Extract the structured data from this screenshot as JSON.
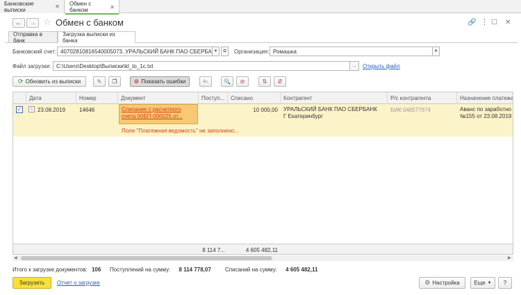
{
  "app_tabs": [
    {
      "label": "Банковские выписки"
    },
    {
      "label": "Обмен с банком"
    }
  ],
  "window": {
    "title": "Обмен с банком",
    "back_icon": "arrow-left-icon",
    "forward_icon": "arrow-right-icon"
  },
  "form_tabs": [
    {
      "label": "Отправка в банк"
    },
    {
      "label": "Загрузка выписки из банка"
    }
  ],
  "account": {
    "label": "Банковский счет:",
    "value": "40702810816540005073, УРАЛЬСКИЙ БАНК ПАО СБЕРБАНК"
  },
  "organization": {
    "label": "Организация:",
    "value": "Ромашка"
  },
  "file": {
    "label": "Файл загрузки:",
    "value": "C:\\Users\\Desktop\\Выписки\\kl_to_1c.txt",
    "browse": "...",
    "open_link": "Открыть файл"
  },
  "toolbar": {
    "refresh_label": "Обновить из выписки",
    "show_errors_label": "Показать ошибки"
  },
  "table": {
    "columns": [
      "Дата",
      "Номер",
      "Документ",
      "Поступ...",
      "Списано",
      "Контрагент",
      "Р/с контрагента",
      "Назначение платежа"
    ],
    "rows": [
      {
        "checked": true,
        "date": "23.08.2019",
        "number": "14646",
        "document_line1": "Списание с расчетного",
        "document_line2": "счета 00БП-000025 от...",
        "income": "",
        "debit": "10 000,00",
        "counterparty_line1": "УРАЛЬСКИЙ БАНК ПАО СБЕРБАНК",
        "counterparty_line2": "Г Екатеринбург",
        "account": "БИК 046577674",
        "purpose_line1": "Аванс по заработно",
        "purpose_line2": "№155 от 23.08.2019",
        "error": "Поле \"Платежная ведомость\" не заполнено..."
      }
    ],
    "totals": {
      "income": "8 114 7...",
      "debit": "4 605 482,11"
    }
  },
  "summary": {
    "docs_label": "Итого к загрузке документов:",
    "docs_value": "106",
    "income_label": "Поступлений на сумму:",
    "income_value": "8 114 778,07",
    "debit_label": "Списаний на сумму:",
    "debit_value": "4 605 482,11"
  },
  "footer": {
    "load_label": "Загрузить",
    "report_link": "Отчет о загрузке",
    "settings_label": "Настройка",
    "more_label": "Еще",
    "help_label": "?"
  }
}
